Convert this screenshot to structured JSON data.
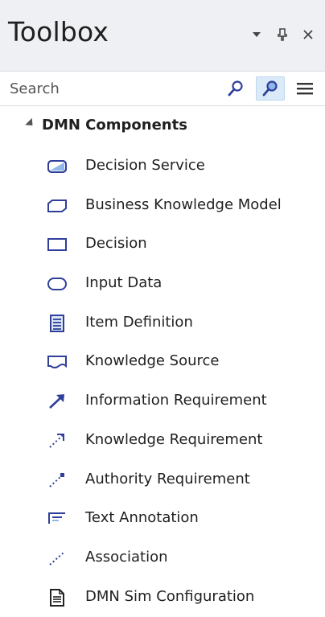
{
  "toolbox": {
    "title": "Toolbox",
    "controls": {
      "dropdown_icon": "chevron-down-icon",
      "pin_icon": "pin-icon",
      "close_icon": "close-icon"
    },
    "search": {
      "placeholder": "Search",
      "value": ""
    },
    "group": {
      "label": "DMN Components",
      "expanded": true
    },
    "items": [
      {
        "label": "Decision Service",
        "icon": "decision-service-icon"
      },
      {
        "label": "Business Knowledge Model",
        "icon": "business-knowledge-model-icon"
      },
      {
        "label": "Decision",
        "icon": "decision-icon"
      },
      {
        "label": "Input Data",
        "icon": "input-data-icon"
      },
      {
        "label": "Item Definition",
        "icon": "item-definition-icon"
      },
      {
        "label": "Knowledge Source",
        "icon": "knowledge-source-icon"
      },
      {
        "label": "Information Requirement",
        "icon": "information-requirement-icon"
      },
      {
        "label": "Knowledge Requirement",
        "icon": "knowledge-requirement-icon"
      },
      {
        "label": "Authority Requirement",
        "icon": "authority-requirement-icon"
      },
      {
        "label": "Text Annotation",
        "icon": "text-annotation-icon"
      },
      {
        "label": "Association",
        "icon": "association-icon"
      },
      {
        "label": "DMN Sim Configuration",
        "icon": "dmn-sim-configuration-icon"
      }
    ],
    "colors": {
      "header_bg": "#eef0f3",
      "icon_blue": "#2f3f9a",
      "icon_light_blue": "#8fb7e8"
    }
  }
}
